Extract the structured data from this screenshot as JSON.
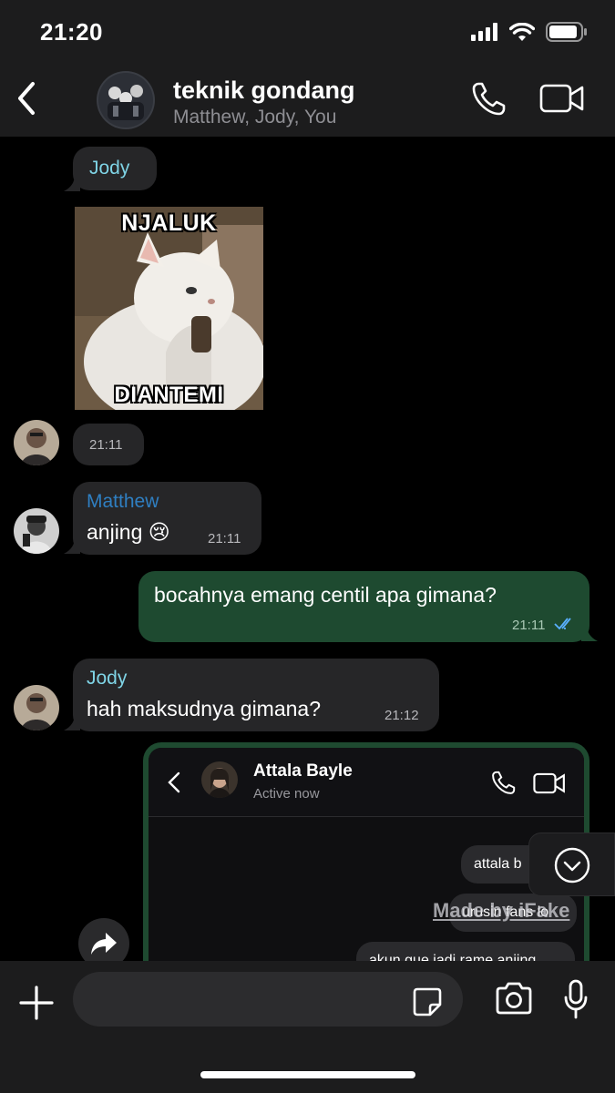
{
  "status_bar": {
    "time": "21:20"
  },
  "chat_header": {
    "title": "teknik gondang",
    "members": "Matthew, Jody, You"
  },
  "messages": [
    {
      "sender": "Jody",
      "type": "sender-label"
    },
    {
      "sender": "Jody",
      "type": "image",
      "meme_top": "NJALUK",
      "meme_bottom": "DIANTEMI",
      "time": "21:11"
    },
    {
      "sender": "Matthew",
      "text": "anjing 😢",
      "time": "21:11"
    },
    {
      "sender": "You",
      "text": "bocahnya emang centil apa gimana?",
      "time": "21:11",
      "read": true
    },
    {
      "sender": "Jody",
      "text": "hah maksudnya gimana?",
      "time": "21:12"
    }
  ],
  "screenshot": {
    "contact_name": "Attala Bayle",
    "contact_status": "Active now",
    "bubbles": [
      "attala b",
      "urusin fans lo",
      "akun gue jadi rame anjing"
    ]
  },
  "watermark": "Made by iFake",
  "colors": {
    "jody_name": "#7fd4e6",
    "matthew_name": "#2f7fc2",
    "outgoing_bubble": "#1e4a30",
    "incoming_bubble": "#262628",
    "read_ticks": "#5ab0ff"
  }
}
